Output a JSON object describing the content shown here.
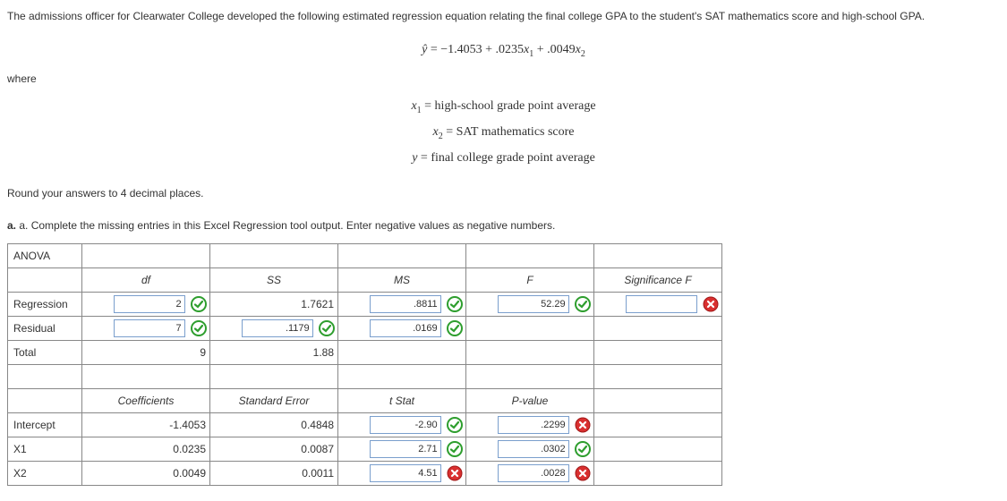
{
  "problem": {
    "intro": "The admissions officer for Clearwater College developed the following estimated regression equation relating the final college GPA to the student's SAT mathematics score and high-school GPA.",
    "equation": "ŷ = −1.4053 + .0235x₁ + .0049x₂",
    "where_label": "where",
    "def_x1": "x₁ = high-school grade point average",
    "def_x2": "x₂ = SAT mathematics score",
    "def_y": "y = final college grade point average",
    "round_note": "Round your answers to 4 decimal places.",
    "part_a": "a. Complete the missing entries in this Excel Regression tool output. Enter negative values as negative numbers."
  },
  "anova": {
    "title": "ANOVA",
    "headers": {
      "df": "df",
      "ss": "SS",
      "ms": "MS",
      "f": "F",
      "sigf": "Significance F"
    },
    "rows": {
      "regression": {
        "label": "Regression",
        "df": "2",
        "df_ok": true,
        "ss": "1.7621",
        "ms": ".8811",
        "ms_ok": true,
        "f": "52.29",
        "f_ok": true,
        "sigf": "",
        "sigf_ok": false
      },
      "residual": {
        "label": "Residual",
        "df": "7",
        "df_ok": true,
        "ss": ".1179",
        "ss_ok": true,
        "ms": ".0169",
        "ms_ok": true
      },
      "total": {
        "label": "Total",
        "df": "9",
        "ss": "1.88"
      }
    }
  },
  "coef": {
    "headers": {
      "coef": "Coefficients",
      "se": "Standard Error",
      "t": "t Stat",
      "p": "P-value"
    },
    "rows": {
      "intercept": {
        "label": "Intercept",
        "coef": "-1.4053",
        "se": "0.4848",
        "t": "-2.90",
        "t_ok": true,
        "p": ".2299",
        "p_ok": false
      },
      "x1": {
        "label": "X1",
        "coef": "0.0235",
        "se": "0.0087",
        "t": "2.71",
        "t_ok": true,
        "p": ".0302",
        "p_ok": true
      },
      "x2": {
        "label": "X2",
        "coef": "0.0049",
        "se": "0.0011",
        "t": "4.51",
        "t_ok": false,
        "p": ".0028",
        "p_ok": false
      }
    }
  }
}
